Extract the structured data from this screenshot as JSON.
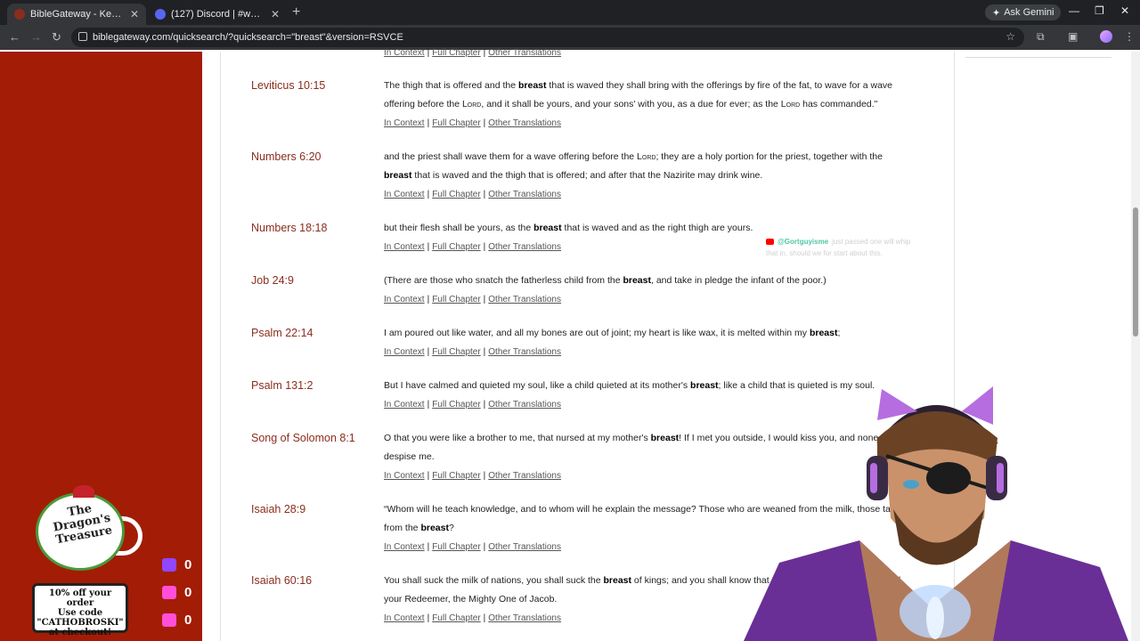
{
  "browser": {
    "tabs": [
      {
        "title": "BibleGateway - Keyword Search",
        "favicon_color": "#8b2d1d"
      },
      {
        "title": "(127) Discord | #wordle-addicts",
        "favicon_color": "#5865f2"
      }
    ],
    "new_tab": "+",
    "ask_gemini": "Ask Gemini",
    "url": "biblegateway.com/quicksearch/?quicksearch=\"breast\"&version=RSVCE"
  },
  "links": {
    "context": "In Context",
    "chapter": "Full Chapter",
    "translations": "Other Translations",
    "sep": "|"
  },
  "verses": [
    {
      "ref": "Leviticus 10:15",
      "parts": [
        "The thigh that is offered and the ",
        "breast",
        " that is waved they shall bring with the offerings by fire of the fat, to wave for a wave offering before the L",
        "ord",
        ", and it shall be yours, and your sons' with you, as a due for ever; as the L",
        "ord",
        " has commanded.\""
      ]
    },
    {
      "ref": "Numbers 6:20",
      "parts": [
        "and the priest shall wave them for a wave offering before the L",
        "ord",
        "; they are a holy portion for the priest, together with the ",
        "breast",
        " that is waved and the thigh that is offered; and after that the Nazirite may drink wine."
      ]
    },
    {
      "ref": "Numbers 18:18",
      "parts": [
        "but their flesh shall be yours, as the ",
        "breast",
        " that is waved and as the right thigh are yours."
      ]
    },
    {
      "ref": "Job 24:9",
      "parts": [
        "(There are those who snatch the fatherless child from the ",
        "breast",
        ", and take in pledge the infant of the poor.)"
      ]
    },
    {
      "ref": "Psalm 22:14",
      "parts": [
        "I am poured out like water, and all my bones are out of joint; my heart is like wax, it is melted within my ",
        "breast",
        ";"
      ]
    },
    {
      "ref": "Psalm 131:2",
      "parts": [
        "But I have calmed and quieted my soul, like a child quieted at its mother's ",
        "breast",
        "; like a child that is quieted is my soul."
      ]
    },
    {
      "ref": "Song of Solomon 8:1",
      "parts": [
        "O that you were like a brother to me, that nursed at my mother's ",
        "breast",
        "! If I met you outside, I would kiss you, and none would despise me."
      ]
    },
    {
      "ref": "Isaiah 28:9",
      "parts": [
        "“Whom will he teach knowledge, and to whom will he explain the message? Those who are weaned from the milk, those taken from the ",
        "breast",
        "?"
      ]
    },
    {
      "ref": "Isaiah 60:16",
      "parts": [
        "You shall suck the milk of nations, you shall suck the ",
        "breast",
        " of kings; and you shall know that I, the L",
        "ord",
        ", am your Savior and your Redeemer, the Mighty One of Jacob."
      ]
    }
  ],
  "overlay": {
    "brand_line1": "The",
    "brand_line2": "Dragon's",
    "brand_line3": "Treasure",
    "promo": [
      "10% off your order",
      "Use code",
      "\"CATHOBROSKI\"",
      "at checkout!"
    ],
    "counters": [
      {
        "icon": "twitch-icon",
        "value": "0",
        "color": "#9146ff"
      },
      {
        "icon": "youtube-icon",
        "value": "0",
        "color": "#ff4fd8"
      },
      {
        "icon": "kick-icon",
        "value": "0",
        "color": "#ff4fd8"
      }
    ],
    "chat": {
      "user": "@Gortguyisme",
      "message": "just passed one will whip that in, should we for start about this."
    }
  }
}
